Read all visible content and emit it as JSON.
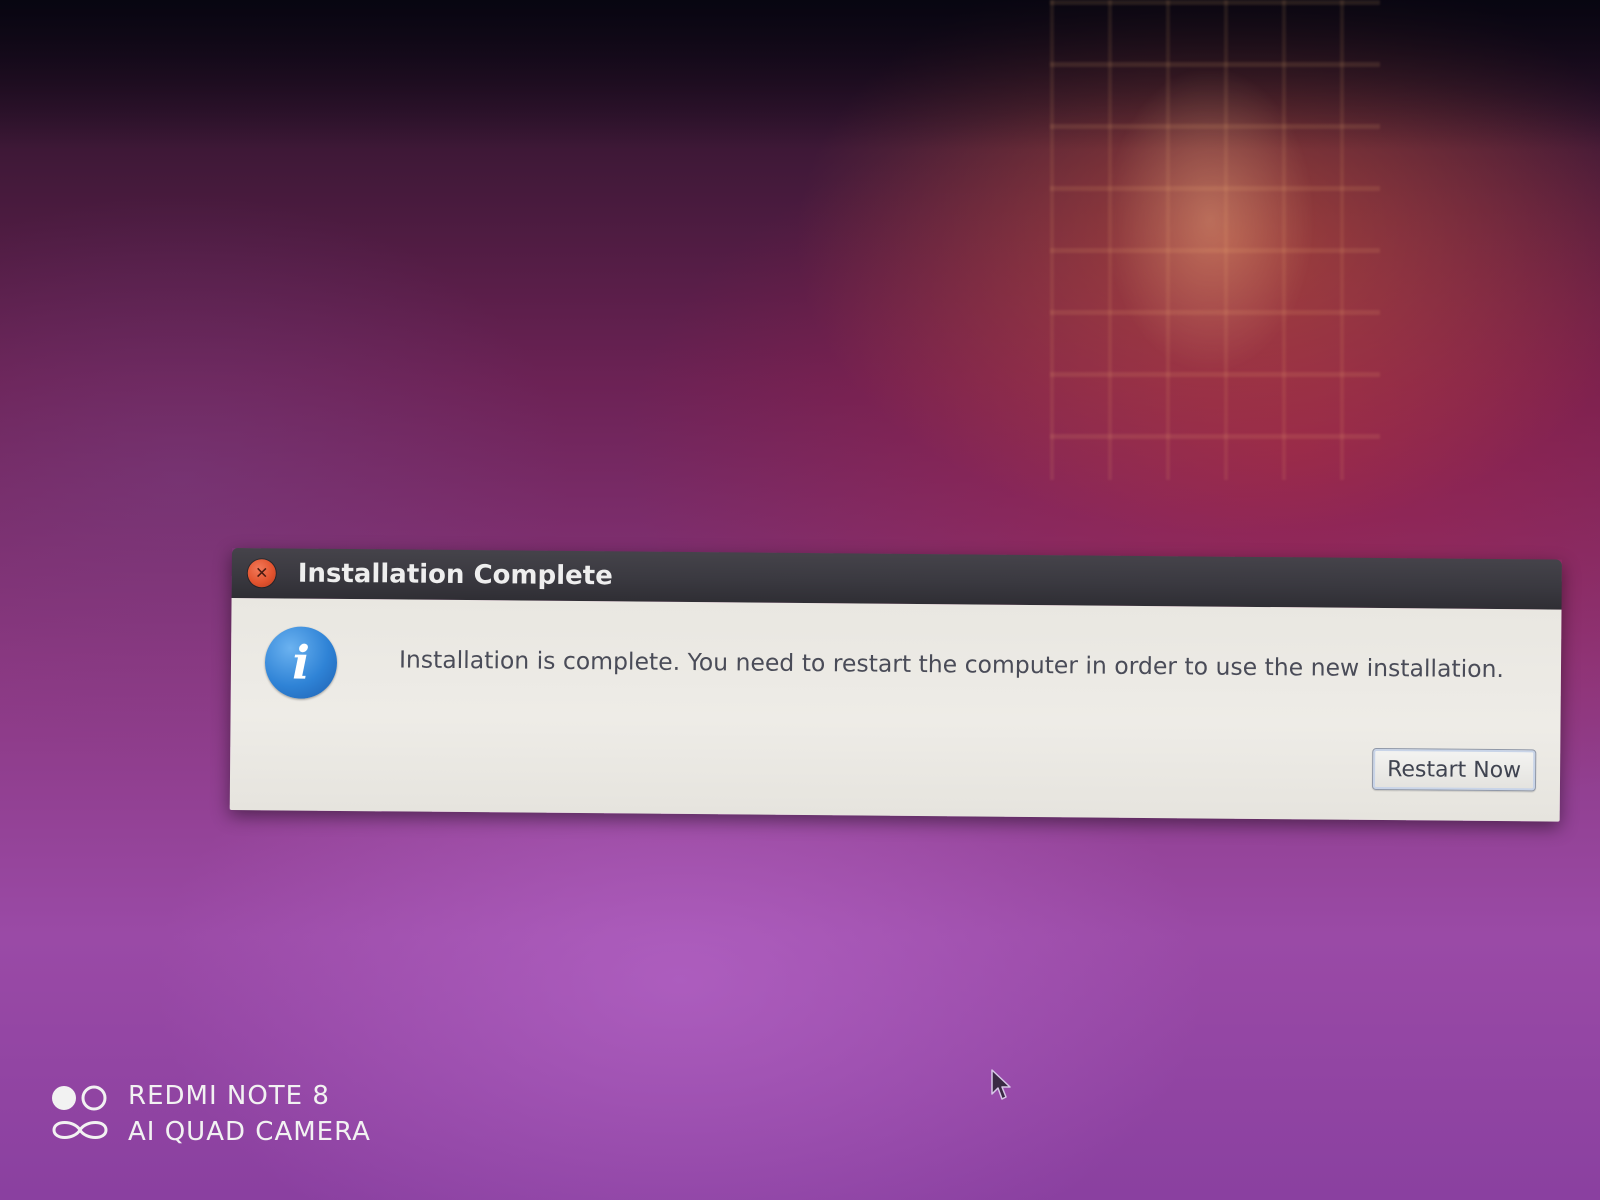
{
  "dialog": {
    "title": "Installation Complete",
    "close_icon": "close-icon",
    "info_icon": "information-icon",
    "info_glyph": "i",
    "message": "Installation is complete. You need to restart the computer in order to use the new installation.",
    "restart_label": "Restart Now"
  },
  "watermark": {
    "logo_icon": "camera-logo-icon",
    "line1": "REDMI NOTE 8",
    "line2": "AI QUAD CAMERA"
  },
  "cursor": {
    "icon": "mouse-pointer-icon"
  },
  "colors": {
    "titlebar": "#3a3940",
    "close_button": "#e3542f",
    "dialog_body": "#eceae5",
    "info_icon": "#2f83d6",
    "message_text": "#4a4c58",
    "wallpaper_purple": "#8a3780"
  }
}
